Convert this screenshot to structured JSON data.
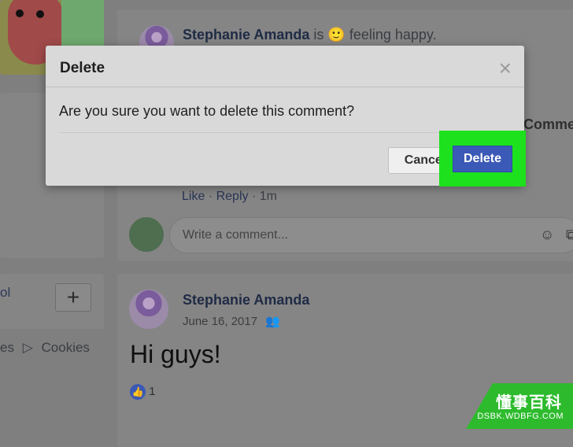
{
  "post1": {
    "author": "Stephanie Amanda",
    "status_text": "is",
    "status_emoji": "🙂",
    "status_tail": "feeling happy.",
    "comment_actions": [
      "Like",
      "Reply",
      "1m"
    ],
    "comment_partial": "Comment",
    "comment_input_placeholder": "Write a comment..."
  },
  "post2": {
    "author": "Stephanie Amanda",
    "date": "June 16, 2017",
    "text": "Hi guys!",
    "reactions_count": "1"
  },
  "sidebar": {
    "label_left": "ol",
    "plus": "+",
    "footer_links": [
      "es",
      "Cookies"
    ]
  },
  "dialog": {
    "title": "Delete",
    "message": "Are you sure you want to delete this comment?",
    "cancel_label": "Cancel",
    "delete_label": "Delete",
    "close_symbol": "×"
  },
  "watermark": {
    "line1": "懂事百科",
    "line2": "DSBK.WDBFG.COM"
  }
}
